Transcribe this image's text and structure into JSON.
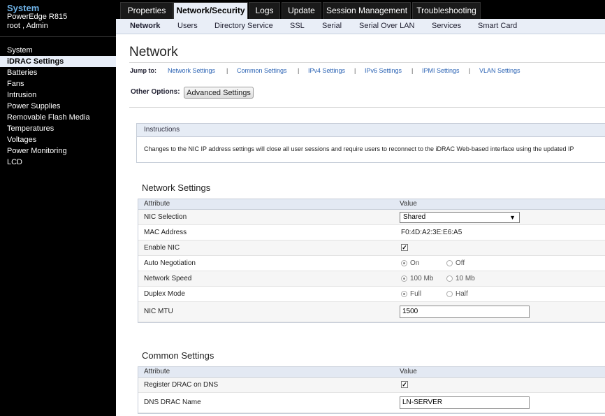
{
  "sidebar": {
    "title": "System",
    "model": "PowerEdge R815",
    "user": "root , Admin",
    "items": [
      {
        "label": "System"
      },
      {
        "label": "iDRAC Settings"
      },
      {
        "label": "Batteries"
      },
      {
        "label": "Fans"
      },
      {
        "label": "Intrusion"
      },
      {
        "label": "Power Supplies"
      },
      {
        "label": "Removable Flash Media"
      },
      {
        "label": "Temperatures"
      },
      {
        "label": "Voltages"
      },
      {
        "label": "Power Monitoring"
      },
      {
        "label": "LCD"
      }
    ],
    "active_item": "iDRAC Settings"
  },
  "top_tabs": [
    {
      "label": "Properties"
    },
    {
      "label": "Network/Security"
    },
    {
      "label": "Logs"
    },
    {
      "label": "Update"
    },
    {
      "label": "Session Management"
    },
    {
      "label": "Troubleshooting"
    }
  ],
  "active_top_tab": "Network/Security",
  "sub_tabs": [
    {
      "label": "Network"
    },
    {
      "label": "Users"
    },
    {
      "label": "Directory Service"
    },
    {
      "label": "SSL"
    },
    {
      "label": "Serial"
    },
    {
      "label": "Serial Over LAN"
    },
    {
      "label": "Services"
    },
    {
      "label": "Smart Card"
    }
  ],
  "active_sub_tab": "Network",
  "page_title": "Network",
  "jump_to": {
    "label": "Jump to:",
    "separator": "|",
    "links": [
      {
        "label": "Network Settings"
      },
      {
        "label": "Common Settings"
      },
      {
        "label": "IPv4 Settings"
      },
      {
        "label": "IPv6 Settings"
      },
      {
        "label": "IPMI Settings"
      },
      {
        "label": "VLAN Settings"
      }
    ]
  },
  "other_options": {
    "label": "Other Options:",
    "button": "Advanced Settings"
  },
  "instructions": {
    "header": "Instructions",
    "text": "Changes to the NIC IP address settings will close all user sessions and require users to reconnect to the iDRAC Web-based interface using the updated IP"
  },
  "network_settings": {
    "title": "Network Settings",
    "col_attribute": "Attribute",
    "col_value": "Value",
    "nic_selection": {
      "label": "NIC Selection",
      "value": "Shared"
    },
    "mac_address": {
      "label": "MAC Address",
      "value": "F0:4D:A2:3E:E6:A5"
    },
    "enable_nic": {
      "label": "Enable NIC",
      "checked": true,
      "mark": "✓"
    },
    "auto_negotiation": {
      "label": "Auto Negotiation",
      "options": [
        "On",
        "Off"
      ],
      "selected": "On"
    },
    "network_speed": {
      "label": "Network Speed",
      "options": [
        "100 Mb",
        "10 Mb"
      ],
      "selected": "100 Mb"
    },
    "duplex_mode": {
      "label": "Duplex Mode",
      "options": [
        "Full",
        "Half"
      ],
      "selected": "Full"
    },
    "nic_mtu": {
      "label": "NIC MTU",
      "value": "1500"
    }
  },
  "common_settings": {
    "title": "Common Settings",
    "col_attribute": "Attribute",
    "col_value": "Value",
    "register_dns": {
      "label": "Register DRAC on DNS",
      "checked": true,
      "mark": "✓"
    },
    "dns_name": {
      "label": "DNS DRAC Name",
      "value": "LN-SERVER"
    }
  },
  "colors": {
    "sidebar_bg": "#000000",
    "sidebar_title": "#6fb3e8",
    "link": "#2b63b4",
    "active_tab_bg": "#e9eef7"
  }
}
